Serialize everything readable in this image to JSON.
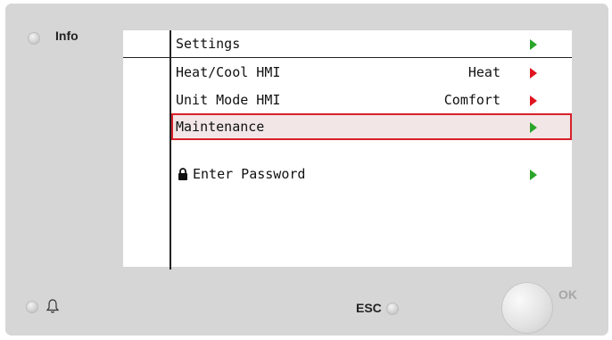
{
  "panel": {
    "info_label": "Info",
    "esc_label": "ESC",
    "ok_label": "OK",
    "bell_icon": "bell-icon"
  },
  "screen": {
    "header": {
      "title": "Settings",
      "arrow_color": "#2aa52a"
    },
    "rows": [
      {
        "label": "Heat/Cool HMI",
        "value": "Heat",
        "arrow_color": "#e0141e"
      },
      {
        "label": "Unit Mode HMI",
        "value": "Comfort",
        "arrow_color": "#e0141e"
      },
      {
        "label": "Maintenance",
        "value": "",
        "arrow_color": "#2aa52a",
        "selected": true
      },
      {
        "label": "Enter Password",
        "value": "",
        "arrow_color": "#2aa52a",
        "icon": "lock-icon"
      }
    ],
    "selection_color": "#d8202a"
  }
}
